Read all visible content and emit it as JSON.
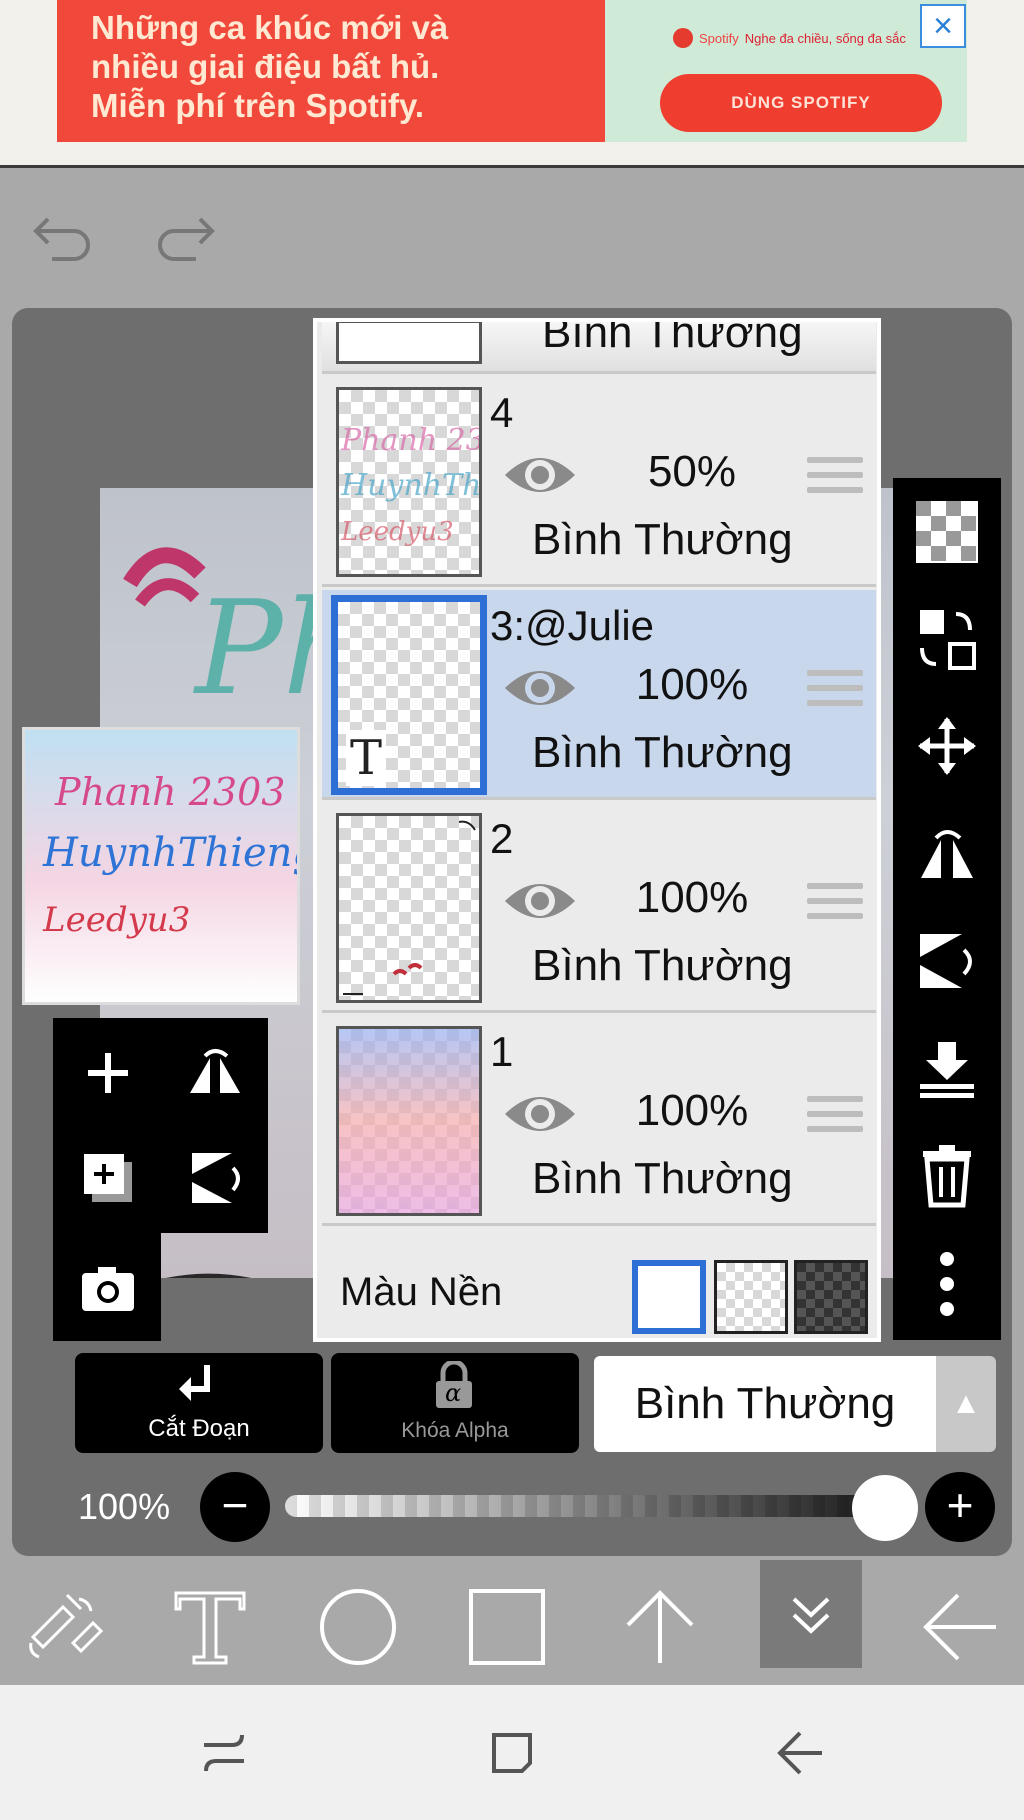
{
  "ad": {
    "line1": "Những ca khúc mới và",
    "line2": "nhiều giai điệu bất hủ.",
    "line3": "Miễn phí trên Spotify.",
    "brand": "Spotify",
    "tagline": "Nghe đa chiều, sống đa sắc",
    "cta": "DÙNG SPOTIFY",
    "close_icon": "×"
  },
  "history": {
    "undo_icon": "undo-icon",
    "redo_icon": "redo-icon"
  },
  "preview": {
    "line1": "Phanh 2303",
    "line2": "HuynhThieng",
    "line3": "Leedyu3"
  },
  "layers": {
    "top_partial": {
      "blend": "Bình Thường"
    },
    "items": [
      {
        "name": "4",
        "opacity": "50%",
        "blend": "Bình Thường",
        "selected": false
      },
      {
        "name": "3:@Julie",
        "opacity": "100%",
        "blend": "Bình Thường",
        "selected": true,
        "type_badge": "T"
      },
      {
        "name": "2",
        "opacity": "100%",
        "blend": "Bình Thường",
        "selected": false
      },
      {
        "name": "1",
        "opacity": "100%",
        "blend": "Bình Thường",
        "selected": false
      }
    ],
    "background_label": "Màu Nền"
  },
  "actions": {
    "clip_label": "Cắt Đoạn",
    "alpha_label": "Khóa Alpha",
    "alpha_glyph": "α",
    "blend_mode": "Bình Thường",
    "blend_arrow": "▲"
  },
  "opacity": {
    "label": "100%",
    "value_fraction": 1.0,
    "minus": "−",
    "plus": "+"
  },
  "colors": {
    "ad_red": "#f0493b",
    "ad_green": "#cfead7",
    "selected_layer": "#c9d7ec",
    "accent_blue": "#2d6fd5"
  }
}
